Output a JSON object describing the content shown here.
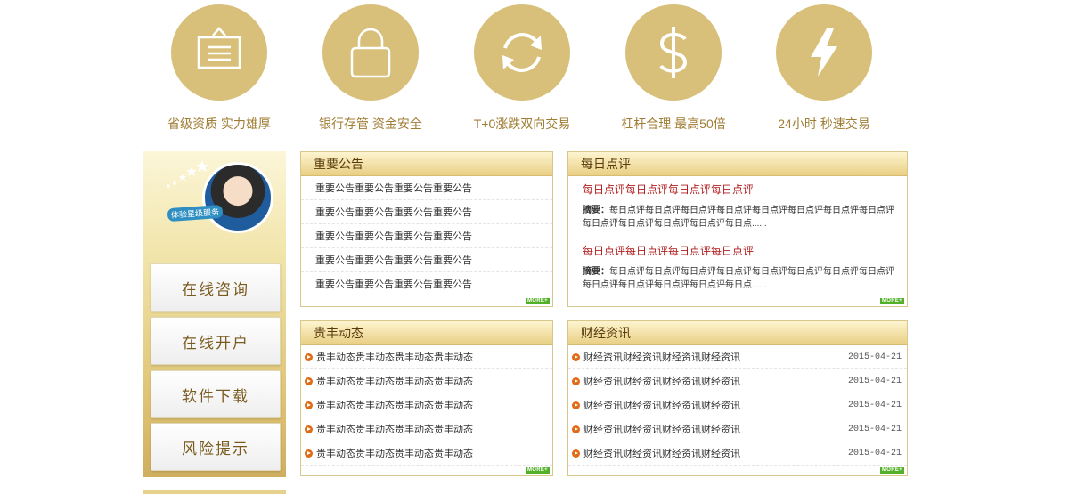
{
  "features": [
    {
      "icon": "notice-board-icon",
      "label": "省级资质 实力雄厚"
    },
    {
      "icon": "lock-icon",
      "label": "银行存管 资金安全"
    },
    {
      "icon": "refresh-icon",
      "label": "T+0涨跌双向交易"
    },
    {
      "icon": "dollar-icon",
      "label": "杠杆合理 最高50倍"
    },
    {
      "icon": "lightning-icon",
      "label": "24小时 秒速交易"
    }
  ],
  "sidebar": {
    "vip_tag": "体验星级服务",
    "buttons": [
      "在线咨询",
      "在线开户",
      "软件下载",
      "风险提示"
    ]
  },
  "announcements": {
    "title": "重要公告",
    "items": [
      "重要公告重要公告重要公告重要公告",
      "重要公告重要公告重要公告重要公告",
      "重要公告重要公告重要公告重要公告",
      "重要公告重要公告重要公告重要公告",
      "重要公告重要公告重要公告重要公告"
    ],
    "more": "MORE+"
  },
  "daily_review": {
    "title": "每日点评",
    "entries": [
      {
        "headline": "每日点评每日点评每日点评每日点评",
        "summary_label": "摘要：",
        "summary": "每日点评每日点评每日点评每日点评每日点评每日点评每日点评每日点评每日点评每日点评每日点评每日点评每日点......"
      },
      {
        "headline": "每日点评每日点评每日点评每日点评",
        "summary_label": "摘要：",
        "summary": "每日点评每日点评每日点评每日点评每日点评每日点评每日点评每日点评每日点评每日点评每日点评每日点评每日点......"
      }
    ],
    "more": "MORE+"
  },
  "dynamics": {
    "title": "贵丰动态",
    "items": [
      "贵丰动态贵丰动态贵丰动态贵丰动态",
      "贵丰动态贵丰动态贵丰动态贵丰动态",
      "贵丰动态贵丰动态贵丰动态贵丰动态",
      "贵丰动态贵丰动态贵丰动态贵丰动态",
      "贵丰动态贵丰动态贵丰动态贵丰动态"
    ],
    "more": "MORE+"
  },
  "finance_news": {
    "title": "财经资讯",
    "items": [
      {
        "text": "财经资讯财经资讯财经资讯财经资讯",
        "date": "2015-04-21"
      },
      {
        "text": "财经资讯财经资讯财经资讯财经资讯",
        "date": "2015-04-21"
      },
      {
        "text": "财经资讯财经资讯财经资讯财经资讯",
        "date": "2015-04-21"
      },
      {
        "text": "财经资讯财经资讯财经资讯财经资讯",
        "date": "2015-04-21"
      },
      {
        "text": "财经资讯财经资讯财经资讯财经资讯",
        "date": "2015-04-21"
      }
    ],
    "more": "MORE+"
  },
  "colors": {
    "gold": "#d8c07a",
    "label_gold": "#a07d34",
    "red_title": "#b01c1c",
    "more_green": "#51b027"
  }
}
